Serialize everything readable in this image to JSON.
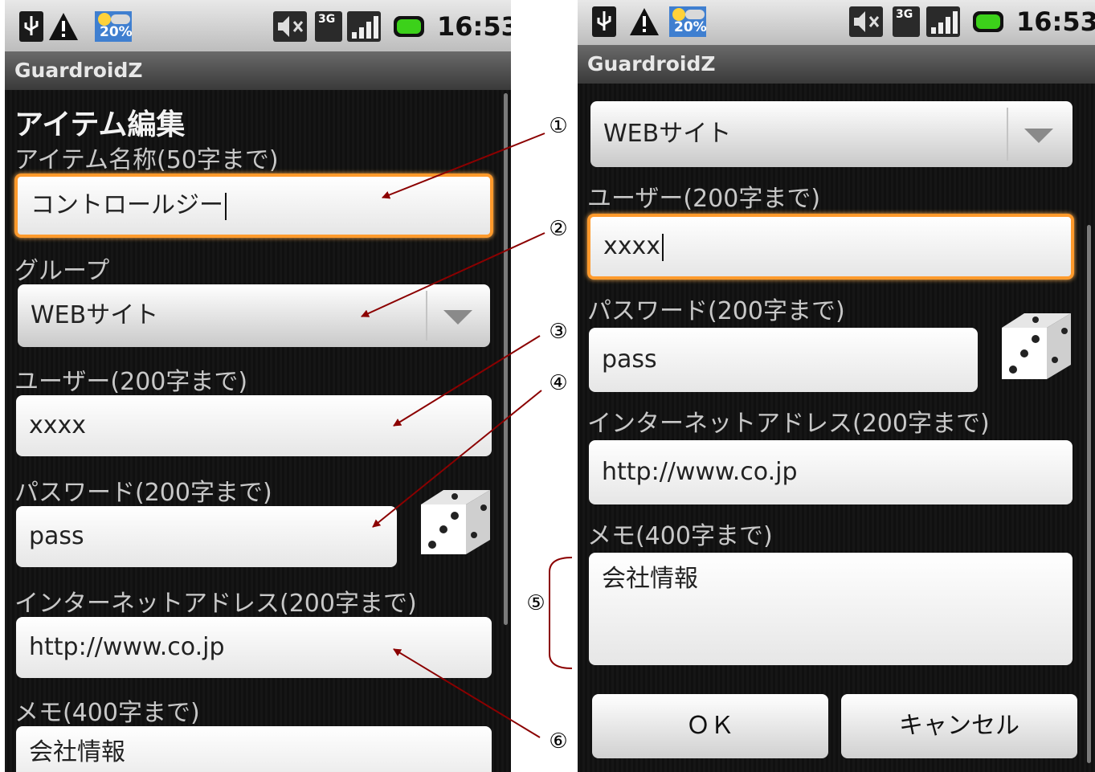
{
  "status_bar": {
    "time": "16:53",
    "battery_badge": "20%",
    "network_badge": "3G",
    "icons": [
      "usb-icon",
      "warning-icon",
      "weather-icon",
      "mute-icon",
      "network-3g-icon",
      "signal-icon",
      "battery-icon"
    ]
  },
  "app": {
    "title": "GuardroidZ"
  },
  "left_screen": {
    "heading": "アイテム編集",
    "name_label": "アイテム名称(50字まで)",
    "name_value": "コントロールジー",
    "group_label": "グループ",
    "group_value": "WEBサイト",
    "user_label": "ユーザー(200字まで)",
    "user_value": "xxxx",
    "password_label": "パスワード(200字まで)",
    "password_value": "pass",
    "url_label": "インターネットアドレス(200字まで)",
    "url_value": "http://www.co.jp",
    "memo_label": "メモ(400字まで)",
    "memo_value": "会社情報"
  },
  "right_screen": {
    "group_value": "WEBサイト",
    "user_label": "ユーザー(200字まで)",
    "user_value": "xxxx",
    "password_label": "パスワード(200字まで)",
    "password_value": "pass",
    "url_label": "インターネットアドレス(200字まで)",
    "url_value": "http://www.co.jp",
    "memo_label": "メモ(400字まで)",
    "memo_value": "会社情報",
    "ok_label": "ＯＫ",
    "cancel_label": "キャンセル"
  },
  "annotations": {
    "m1": "①",
    "m2": "②",
    "m3": "③",
    "m4": "④",
    "m5": "⑤",
    "m6": "⑥",
    "arrow_color": "#8b0000"
  },
  "colors": {
    "focus": "#ff9a2c",
    "arrow": "#8b0000"
  }
}
